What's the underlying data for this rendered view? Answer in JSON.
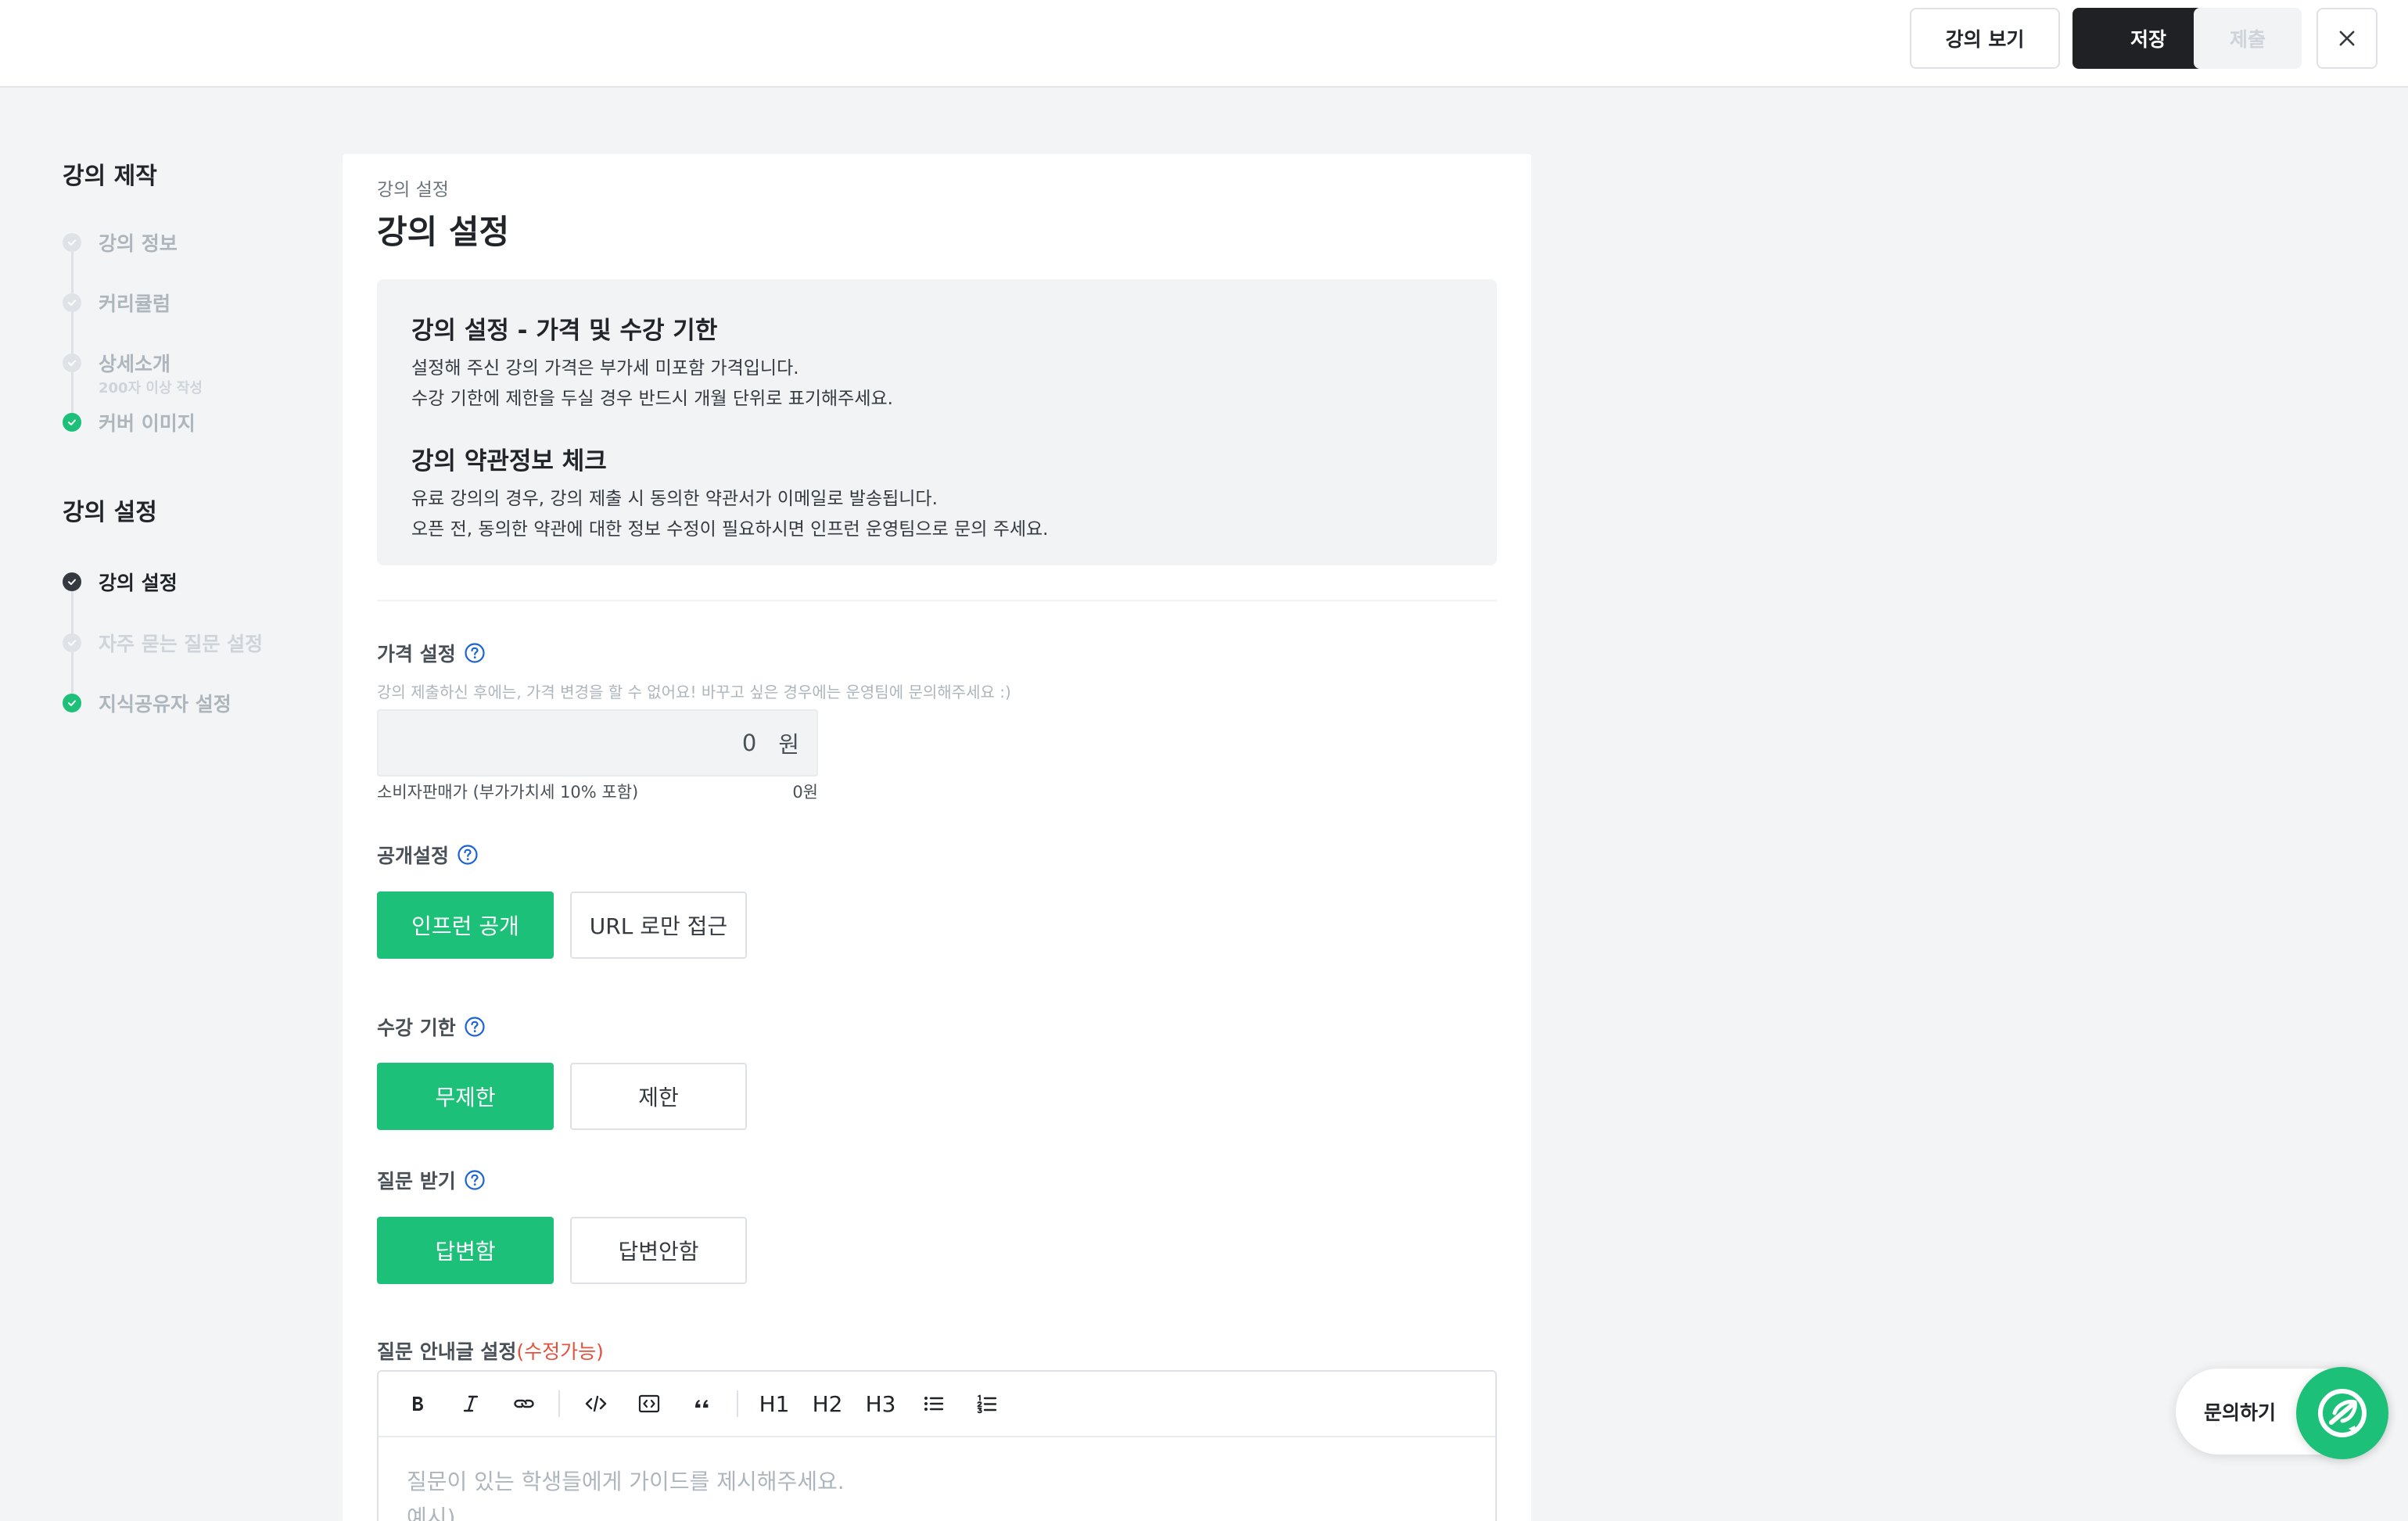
{
  "header": {
    "preview_label": "강의 보기",
    "save_label": "저장",
    "submit_label": "제출",
    "close_icon": "close-icon"
  },
  "sidebar": {
    "section1_title": "강의 제작",
    "section1_items": [
      {
        "label": "강의 정보",
        "state": "done"
      },
      {
        "label": "커리큘럼",
        "state": "done"
      },
      {
        "label": "상세소개",
        "sub": "200자 이상 작성",
        "state": "done"
      },
      {
        "label": "커버 이미지",
        "state": "complete"
      }
    ],
    "section2_title": "강의 설정",
    "section2_items": [
      {
        "label": "강의 설정",
        "state": "active"
      },
      {
        "label": "자주 묻는 질문 설정",
        "state": "done"
      },
      {
        "label": "지식공유자 설정",
        "state": "complete"
      }
    ]
  },
  "main": {
    "breadcrumb": "강의 설정",
    "title": "강의 설정",
    "info": {
      "block1_title": "강의 설정 - 가격 및 수강 기한",
      "block1_line1": "설정해 주신 강의 가격은 부가세 미포함 가격입니다.",
      "block1_line2": "수강 기한에 제한을 두실 경우 반드시 개월 단위로 표기해주세요.",
      "block2_title": "강의 약관정보 체크",
      "block2_line1": "유료 강의의 경우, 강의 제출 시 동의한 약관서가 이메일로 발송됩니다.",
      "block2_line2": "오픈 전, 동의한 약관에 대한 정보 수정이 필요하시면 인프런 운영팀으로 문의 주세요."
    },
    "price": {
      "label": "가격 설정",
      "hint": "강의 제출하신 후에는, 가격 변경을 할 수 없어요! 바꾸고 싶은 경우에는 운영팀에 문의해주세요 :)",
      "value": "0",
      "unit": "원",
      "consumer_label": "소비자판매가 (부가가치세 10% 포함)",
      "consumer_value": "0원"
    },
    "visibility": {
      "label": "공개설정",
      "options": [
        "인프런 공개",
        "URL 로만 접근"
      ],
      "selected": "인프런 공개"
    },
    "period": {
      "label": "수강 기한",
      "options": [
        "무제한",
        "제한"
      ],
      "selected": "무제한"
    },
    "questions": {
      "label": "질문 받기",
      "options": [
        "답변함",
        "답변안함"
      ],
      "selected": "답변함"
    },
    "guide": {
      "label": "질문 안내글 설정",
      "editable_tag": "(수정가능)",
      "toolbar": {
        "h1": "H1",
        "h2": "H2",
        "h3": "H3"
      },
      "placeholder_line1": "질문이 있는 학생들에게 가이드를 제시해주세요.",
      "placeholder_line2": "예시)"
    }
  },
  "contact": {
    "label": "문의하기"
  },
  "colors": {
    "accent_green": "#1dc078",
    "dark": "#1f2124",
    "editable_red": "#e5503c"
  }
}
